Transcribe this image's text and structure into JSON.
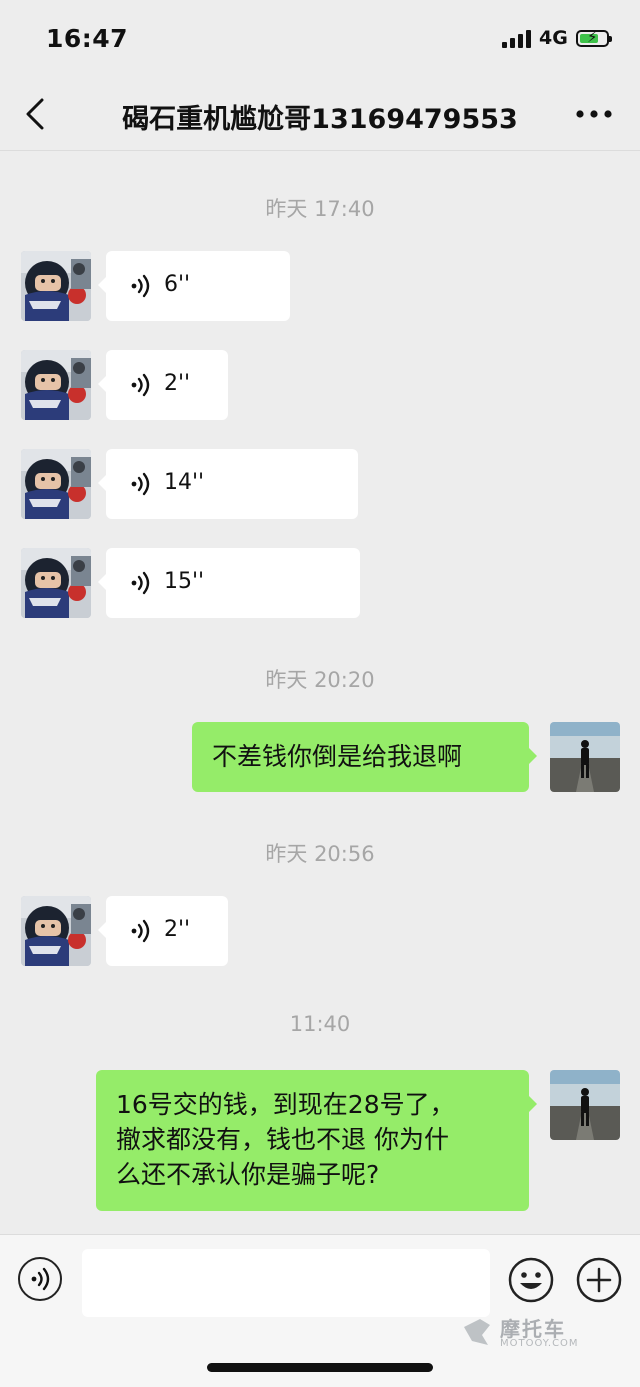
{
  "status_bar": {
    "time": "16:47",
    "network": "4G"
  },
  "header": {
    "title": "碣石重机尴尬哥13169479553"
  },
  "messages": [
    {
      "kind": "timestamp",
      "text": "昨天 17:40"
    },
    {
      "kind": "voice",
      "duration": "6''"
    },
    {
      "kind": "voice",
      "duration": "2''"
    },
    {
      "kind": "voice",
      "duration": "14''"
    },
    {
      "kind": "voice",
      "duration": "15''"
    },
    {
      "kind": "timestamp",
      "text": "昨天 20:20"
    },
    {
      "kind": "text",
      "lines": [
        "不差钱你倒是给我退啊"
      ]
    },
    {
      "kind": "timestamp",
      "text": "昨天 20:56"
    },
    {
      "kind": "voice",
      "duration": "2''"
    },
    {
      "kind": "timestamp",
      "text": "11:40"
    },
    {
      "kind": "text",
      "lines": [
        "16号交的钱，到现在28号了，",
        "撤求都没有，钱也不退 你为什",
        "么还不承认你是骗子呢?"
      ]
    }
  ],
  "watermark": {
    "brand_cn": "摩托车",
    "domain": "MOTOOY.COM"
  },
  "colors": {
    "background": "#ededed",
    "bubble_in": "#ffffff",
    "bubble_out": "#95ec69",
    "timestamp": "#a6a6a6"
  },
  "icons": [
    "back-chevron-icon",
    "more-dots-icon",
    "voice-wave-icon",
    "microphone-icon",
    "emoji-icon",
    "plus-icon"
  ]
}
